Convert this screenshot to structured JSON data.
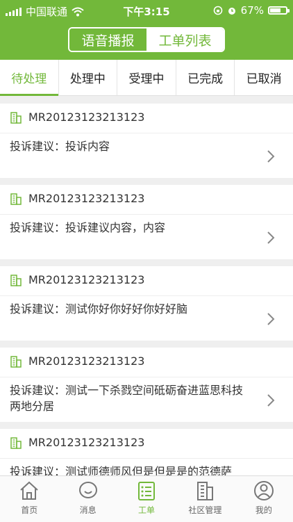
{
  "status": {
    "carrier": "中国联通",
    "time": "下午3:15",
    "battery": "67%",
    "battery_level": 0.67
  },
  "header": {
    "segments": [
      {
        "label": "语音播报",
        "active": true
      },
      {
        "label": "工单列表",
        "active": false
      }
    ]
  },
  "tabs": [
    {
      "label": "待处理",
      "selected": true
    },
    {
      "label": "处理中"
    },
    {
      "label": "受理中"
    },
    {
      "label": "已完成"
    },
    {
      "label": "已取消"
    }
  ],
  "orders": [
    {
      "id": "MR20123123213123",
      "content": "投诉建议：投诉内容"
    },
    {
      "id": "MR20123123213123",
      "content": "投诉建议：投诉建议内容，内容"
    },
    {
      "id": "MR20123123213123",
      "content": "投诉建议：测试你好你好好你好好脑"
    },
    {
      "id": "MR20123123213123",
      "content": "投诉建议：测试一下杀戮空间砥砺奋进蓝思科技两地分居"
    },
    {
      "id": "MR20123123213123",
      "content": "投诉建议：测试师德师风但是但是是的范德萨"
    }
  ],
  "bottom_nav": [
    {
      "label": "首页"
    },
    {
      "label": "消息"
    },
    {
      "label": "工单",
      "selected": true
    },
    {
      "label": "社区管理"
    },
    {
      "label": "我的"
    }
  ],
  "colors": {
    "accent": "#72b83a"
  }
}
